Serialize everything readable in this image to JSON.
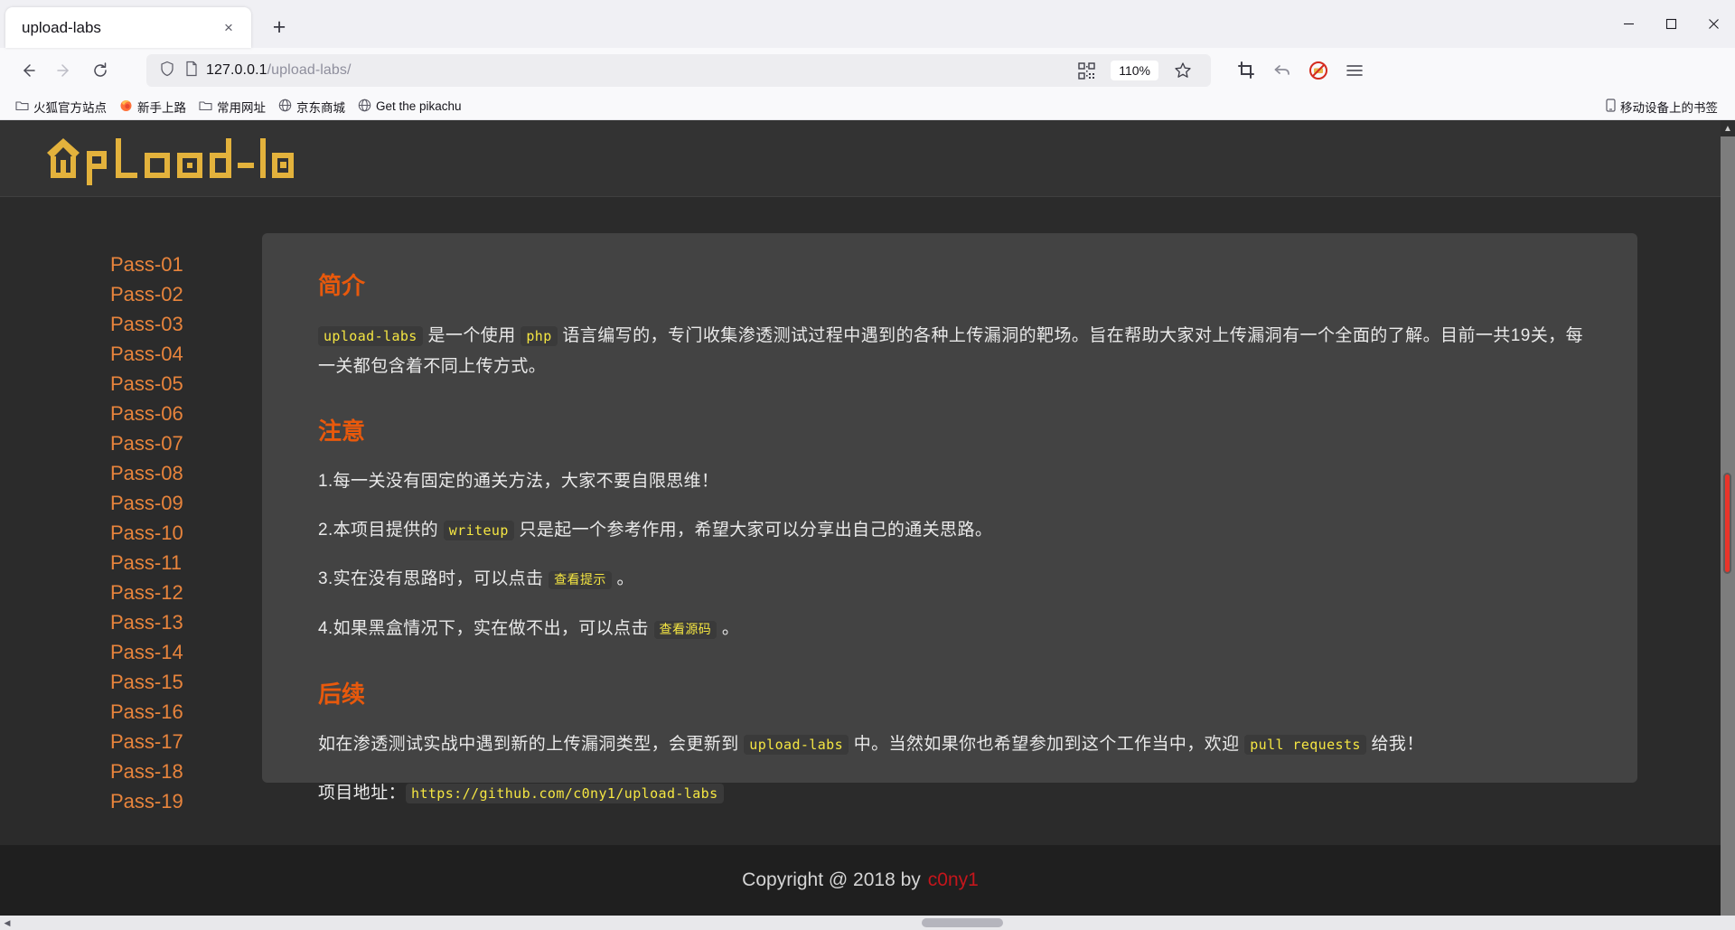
{
  "browser": {
    "tab": {
      "title": "upload-labs",
      "close_label": "×"
    },
    "new_tab_label": "+",
    "window_controls": {
      "minimize": "─",
      "maximize": "☐",
      "close": "✕"
    },
    "nav": {
      "back": "←",
      "forward": "→",
      "reload": "↻"
    },
    "url": {
      "host": "127.0.0.1",
      "path": "/upload-labs/"
    },
    "zoom_level": "110%",
    "toolbar_icons": [
      "shield-icon",
      "page-icon",
      "qr-code-icon",
      "star-icon",
      "screenshot-icon",
      "undo-icon",
      "adblock-icon",
      "menu-icon"
    ],
    "bookmarks": [
      {
        "label": "火狐官方站点",
        "icon": "folder-icon"
      },
      {
        "label": "新手上路",
        "icon": "firefox-icon"
      },
      {
        "label": "常用网址",
        "icon": "folder-icon"
      },
      {
        "label": "京东商城",
        "icon": "globe-icon"
      },
      {
        "label": "Get the pikachu",
        "icon": "globe-icon"
      }
    ],
    "bookmarks_right": {
      "label": "移动设备上的书签",
      "icon": "mobile-icon"
    }
  },
  "site": {
    "logo_text": "upload-labs",
    "sidebar": {
      "items": [
        {
          "label": "Pass-01"
        },
        {
          "label": "Pass-02"
        },
        {
          "label": "Pass-03"
        },
        {
          "label": "Pass-04"
        },
        {
          "label": "Pass-05"
        },
        {
          "label": "Pass-06"
        },
        {
          "label": "Pass-07"
        },
        {
          "label": "Pass-08"
        },
        {
          "label": "Pass-09"
        },
        {
          "label": "Pass-10"
        },
        {
          "label": "Pass-11"
        },
        {
          "label": "Pass-12"
        },
        {
          "label": "Pass-13"
        },
        {
          "label": "Pass-14"
        },
        {
          "label": "Pass-15"
        },
        {
          "label": "Pass-16"
        },
        {
          "label": "Pass-17"
        },
        {
          "label": "Pass-18"
        },
        {
          "label": "Pass-19"
        }
      ]
    },
    "sections": {
      "intro": {
        "heading": "简介",
        "code_1": "upload-labs",
        "text_1": "是一个使用",
        "code_2": "php",
        "text_2": "语言编写的，专门收集渗透测试过程中遇到的各种上传漏洞的靶场。旨在帮助大家对上传漏洞有一个全面的了解。目前一共19关，每一关都包含着不同上传方式。"
      },
      "notice": {
        "heading": "注意",
        "item_1": "1.每一关没有固定的通关方法，大家不要自限思维！",
        "item_2_a": "2.本项目提供的",
        "item_2_code": "writeup",
        "item_2_b": "只是起一个参考作用，希望大家可以分享出自己的通关思路。",
        "item_3_a": "3.实在没有思路时，可以点击",
        "item_3_code": "查看提示",
        "item_3_b": "。",
        "item_4_a": "4.如果黑盒情况下，实在做不出，可以点击",
        "item_4_code": "查看源码",
        "item_4_b": "。"
      },
      "followup": {
        "heading": "后续",
        "text_1": "如在渗透测试实战中遇到新的上传漏洞类型，会更新到",
        "code_1": "upload-labs",
        "text_2": "中。当然如果你也希望参加到这个工作当中，欢迎",
        "code_2": "pull requests",
        "text_3": "给我！",
        "addr_label": "项目地址：",
        "addr_code": "https://github.com/c0ny1/upload-labs"
      }
    },
    "footer": {
      "text": "Copyright @ 2018 by",
      "author": "c0ny1"
    }
  },
  "colors": {
    "accent_orange": "#e8590c",
    "link_orange": "#e8843c",
    "logo_gold": "#e3b23c",
    "code_yellow": "#f5e642",
    "author_red": "#c4161c"
  }
}
